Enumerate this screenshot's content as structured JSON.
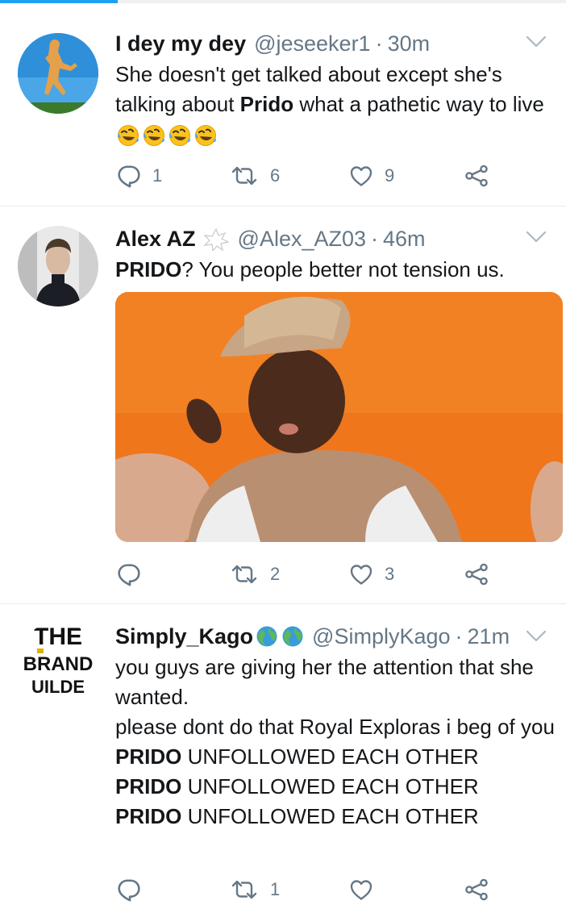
{
  "tweets": [
    {
      "name": "I dey my dey",
      "handle": "@jeseeker1",
      "separator": "·",
      "time": "30m",
      "text_parts": [
        "She doesn't get talked about except she's talking about ",
        "Prido",
        " what a pathetic way to live"
      ],
      "emojis": [
        "rolling-on-floor-laughing-emoji",
        "rolling-on-floor-laughing-emoji",
        "rolling-on-floor-laughing-emoji",
        "rolling-on-floor-laughing-emoji"
      ],
      "reply_count": "1",
      "retweet_count": "6",
      "like_count": "9"
    },
    {
      "name": "Alex AZ",
      "handle": "@Alex_AZ03",
      "separator": "·",
      "time": "46m",
      "text_parts": [
        "PRIDO",
        "? You people better not tension us."
      ],
      "reply_count": "",
      "retweet_count": "2",
      "like_count": "3"
    },
    {
      "name": "Simply_Kago",
      "name_emojis": [
        "globe-emoji",
        "globe-emoji"
      ],
      "handle": "@SimplyKago",
      "separator": "·",
      "time": "21m",
      "line1": "you guys are giving her the attention that she wanted.",
      "line2": "please dont do that Royal Exploras i beg of you",
      "shout_bold": "PRIDO",
      "shout_rest": " UNFOLLOWED EACH OTHER",
      "avatar_logo": {
        "top": "THE",
        "middle": "BRAND",
        "bottom": "UILDE"
      },
      "reply_count": "",
      "retweet_count": "1",
      "like_count": ""
    }
  ],
  "colors": {
    "accent": "#1da1f2",
    "muted": "#657786",
    "divider": "#e6ecf0",
    "media_bg": "#f0761c"
  },
  "icons": [
    "reply-icon",
    "retweet-icon",
    "like-icon",
    "share-icon",
    "chevron-down-icon"
  ]
}
